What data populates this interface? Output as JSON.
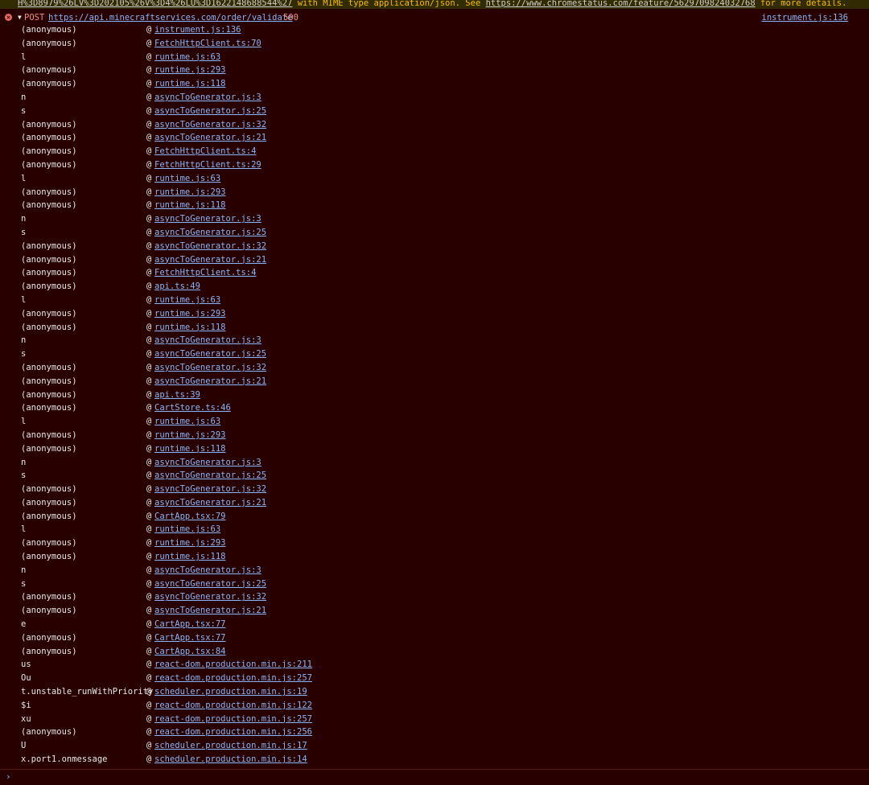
{
  "warning": {
    "link1": "H%3D8979%26LV%3D202105%26V%3D4%26LU%3D1622148688544%27",
    "text": " with MIME type application/json. See ",
    "link2": "https://www.chromestatus.com/feature/5629709824032768",
    "tail": " for more details."
  },
  "error": {
    "icon": "error-circle-icon",
    "toggle": "▼",
    "method": "POST",
    "url": "https://api.minecraftservices.com/order/validate",
    "status": "500",
    "source": "instrument.js:136"
  },
  "stack": [
    {
      "fn": "(anonymous)",
      "loc": "instrument.js:136"
    },
    {
      "fn": "(anonymous)",
      "loc": "FetchHttpClient.ts:70"
    },
    {
      "fn": "l",
      "loc": "runtime.js:63"
    },
    {
      "fn": "(anonymous)",
      "loc": "runtime.js:293"
    },
    {
      "fn": "(anonymous)",
      "loc": "runtime.js:118"
    },
    {
      "fn": "n",
      "loc": "asyncToGenerator.js:3"
    },
    {
      "fn": "s",
      "loc": "asyncToGenerator.js:25"
    },
    {
      "fn": "(anonymous)",
      "loc": "asyncToGenerator.js:32"
    },
    {
      "fn": "(anonymous)",
      "loc": "asyncToGenerator.js:21"
    },
    {
      "fn": "(anonymous)",
      "loc": "FetchHttpClient.ts:4"
    },
    {
      "fn": "(anonymous)",
      "loc": "FetchHttpClient.ts:29"
    },
    {
      "fn": "l",
      "loc": "runtime.js:63"
    },
    {
      "fn": "(anonymous)",
      "loc": "runtime.js:293"
    },
    {
      "fn": "(anonymous)",
      "loc": "runtime.js:118"
    },
    {
      "fn": "n",
      "loc": "asyncToGenerator.js:3"
    },
    {
      "fn": "s",
      "loc": "asyncToGenerator.js:25"
    },
    {
      "fn": "(anonymous)",
      "loc": "asyncToGenerator.js:32"
    },
    {
      "fn": "(anonymous)",
      "loc": "asyncToGenerator.js:21"
    },
    {
      "fn": "(anonymous)",
      "loc": "FetchHttpClient.ts:4"
    },
    {
      "fn": "(anonymous)",
      "loc": "api.ts:49"
    },
    {
      "fn": "l",
      "loc": "runtime.js:63"
    },
    {
      "fn": "(anonymous)",
      "loc": "runtime.js:293"
    },
    {
      "fn": "(anonymous)",
      "loc": "runtime.js:118"
    },
    {
      "fn": "n",
      "loc": "asyncToGenerator.js:3"
    },
    {
      "fn": "s",
      "loc": "asyncToGenerator.js:25"
    },
    {
      "fn": "(anonymous)",
      "loc": "asyncToGenerator.js:32"
    },
    {
      "fn": "(anonymous)",
      "loc": "asyncToGenerator.js:21"
    },
    {
      "fn": "(anonymous)",
      "loc": "api.ts:39"
    },
    {
      "fn": "(anonymous)",
      "loc": "CartStore.ts:46"
    },
    {
      "fn": "l",
      "loc": "runtime.js:63"
    },
    {
      "fn": "(anonymous)",
      "loc": "runtime.js:293"
    },
    {
      "fn": "(anonymous)",
      "loc": "runtime.js:118"
    },
    {
      "fn": "n",
      "loc": "asyncToGenerator.js:3"
    },
    {
      "fn": "s",
      "loc": "asyncToGenerator.js:25"
    },
    {
      "fn": "(anonymous)",
      "loc": "asyncToGenerator.js:32"
    },
    {
      "fn": "(anonymous)",
      "loc": "asyncToGenerator.js:21"
    },
    {
      "fn": "(anonymous)",
      "loc": "CartApp.tsx:79"
    },
    {
      "fn": "l",
      "loc": "runtime.js:63"
    },
    {
      "fn": "(anonymous)",
      "loc": "runtime.js:293"
    },
    {
      "fn": "(anonymous)",
      "loc": "runtime.js:118"
    },
    {
      "fn": "n",
      "loc": "asyncToGenerator.js:3"
    },
    {
      "fn": "s",
      "loc": "asyncToGenerator.js:25"
    },
    {
      "fn": "(anonymous)",
      "loc": "asyncToGenerator.js:32"
    },
    {
      "fn": "(anonymous)",
      "loc": "asyncToGenerator.js:21"
    },
    {
      "fn": "e",
      "loc": "CartApp.tsx:77"
    },
    {
      "fn": "(anonymous)",
      "loc": "CartApp.tsx:77"
    },
    {
      "fn": "(anonymous)",
      "loc": "CartApp.tsx:84"
    },
    {
      "fn": "us",
      "loc": "react-dom.production.min.js:211"
    },
    {
      "fn": "Ou",
      "loc": "react-dom.production.min.js:257"
    },
    {
      "fn": "t.unstable_runWithPriority",
      "loc": "scheduler.production.min.js:19"
    },
    {
      "fn": "$i",
      "loc": "react-dom.production.min.js:122"
    },
    {
      "fn": "xu",
      "loc": "react-dom.production.min.js:257"
    },
    {
      "fn": "(anonymous)",
      "loc": "react-dom.production.min.js:256"
    },
    {
      "fn": "U",
      "loc": "scheduler.production.min.js:17"
    },
    {
      "fn": "x.port1.onmessage",
      "loc": "scheduler.production.min.js:14"
    }
  ],
  "stack_at": "@",
  "prompt": {
    "icon": "chevron-right-icon",
    "glyph": "›"
  }
}
